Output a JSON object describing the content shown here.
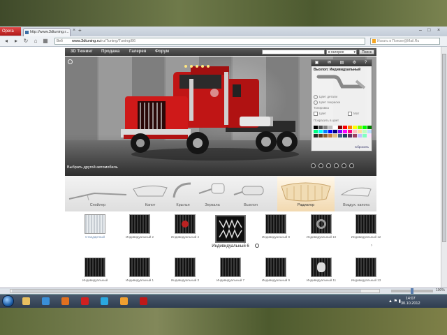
{
  "browser": {
    "menu_label": "Opera",
    "tab_title": "http://www.3dtuning.r...",
    "tab_close": "×",
    "new_tab": "+",
    "window_controls": [
      "–",
      "□",
      "×"
    ],
    "url_prefix": "Веб",
    "url_domain": "www.3dtuning.ru",
    "url_path": "/ru/Tuning/Tuning/86",
    "search_placeholder": "Искать в Поиске@Mail.Ru",
    "zoom": "100%"
  },
  "site": {
    "nav": [
      "3D Тюнинг",
      "Продажа",
      "Галерея",
      "Форум"
    ],
    "search_scope": "в галерее",
    "search_button": "Поиск",
    "choose_car": "Выбрать другой автомобиль",
    "panel": {
      "title": "Выхлоп: Индивидуальный",
      "options": [
        "Цвет детали",
        "Цвет покраски",
        "Тонировка",
        "Цвет",
        "Мат",
        "Покрасить в цвет"
      ],
      "reset": "Сбросить",
      "palette": [
        "#000000",
        "#4a4a4a",
        "#7f7f7f",
        "#bfbfbf",
        "#ffffff",
        "#7f0000",
        "#ff0000",
        "#ff7f00",
        "#ffff00",
        "#7fff00",
        "#00ff00",
        "#007f00",
        "#00ff7f",
        "#00ffff",
        "#007fff",
        "#0000ff",
        "#00007f",
        "#7f00ff",
        "#ff00ff",
        "#ff007f",
        "#ffbfbf",
        "#ffdf9f",
        "#bfffbf",
        "#bfdfff",
        "#2a2a2a",
        "#5c3a1e",
        "#8b5a2b",
        "#c08040",
        "#e0c080",
        "#406080",
        "#204060",
        "#603060",
        "#a04060",
        "#c0c0ff",
        "#80ffc0",
        "#ffe0ff"
      ]
    },
    "parts": [
      "Спойлер",
      "Капот",
      "Крылья",
      "Зеркала",
      "Выхлоп",
      "Радиатор",
      "Воздух. капота"
    ],
    "thumbs_row1": [
      {
        "caption": "Стандартный"
      },
      {
        "caption": "Индивидуальный 2"
      },
      {
        "caption": "Индивидуальный 4"
      },
      {
        "caption": "Индивидуальный 8"
      },
      {
        "caption": "Индивидуальный 10"
      },
      {
        "caption": "Индивидуальный 12"
      }
    ],
    "thumb_selected": "Индивидуальный 6",
    "thumbs_row2": [
      {
        "caption": "Индивидуальный"
      },
      {
        "caption": "Индивидуальный 1"
      },
      {
        "caption": "Индивидуальный 3"
      },
      {
        "caption": "Индивидуальный 7"
      },
      {
        "caption": "Индивидуальный 9"
      },
      {
        "caption": "Индивидуальный 11"
      },
      {
        "caption": "Индивидуальный 13"
      }
    ]
  },
  "taskbar": {
    "apps": [
      {
        "name": "explorer",
        "color": "#e8c060"
      },
      {
        "name": "ie",
        "color": "#3a8fd8"
      },
      {
        "name": "firefox",
        "color": "#e07020"
      },
      {
        "name": "opera",
        "color": "#d02020"
      },
      {
        "name": "skype",
        "color": "#2aa8e0"
      },
      {
        "name": "media",
        "color": "#f0a030"
      },
      {
        "name": "app-red",
        "color": "#c01818"
      }
    ],
    "time": "14:07",
    "date": "30.10.2012",
    "tray": "▲ ⚑ ▮"
  }
}
